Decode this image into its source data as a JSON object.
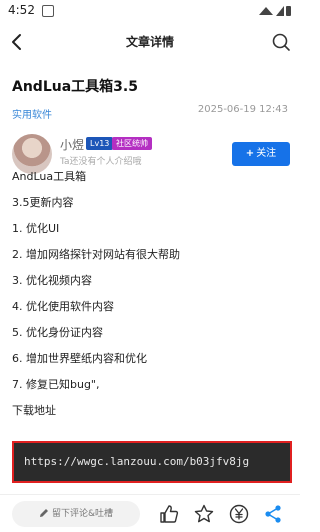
{
  "status_bar": {
    "time": "4:52"
  },
  "nav": {
    "title": "文章详情"
  },
  "article": {
    "title": "AndLua工具箱3.5",
    "category": "实用软件",
    "date": "2025-06-19 12:43"
  },
  "author": {
    "name": "小煜",
    "level": "Lv13",
    "role": "社区统帅",
    "bio": "Ta还没有个人介绍哦",
    "follow_label": "关注"
  },
  "content_lines": [
    "AndLua工具箱",
    "3.5更新内容",
    "1. 优化UI",
    "2. 增加网络探针对网站有很大帮助",
    "3. 优化视频内容",
    "4. 优化使用软件内容",
    "5. 优化身份证内容",
    "6. 增加世界壁纸内容和优化",
    "7. 修复已知bug\",",
    "下载地址"
  ],
  "download": {
    "url": "https://wwgc.lanzouu.com/b03jfv8jg"
  },
  "bottom_bar": {
    "comment_placeholder": "留下评论&吐槽"
  },
  "colors": {
    "accent": "#1672e8",
    "link": "#3a88d8",
    "highlight_border": "#e02020",
    "code_bg": "#2b2b2b"
  },
  "icons": [
    "back-arrow-icon",
    "search-icon",
    "like-icon",
    "star-icon",
    "yen-icon",
    "share-icon",
    "pencil-icon"
  ]
}
